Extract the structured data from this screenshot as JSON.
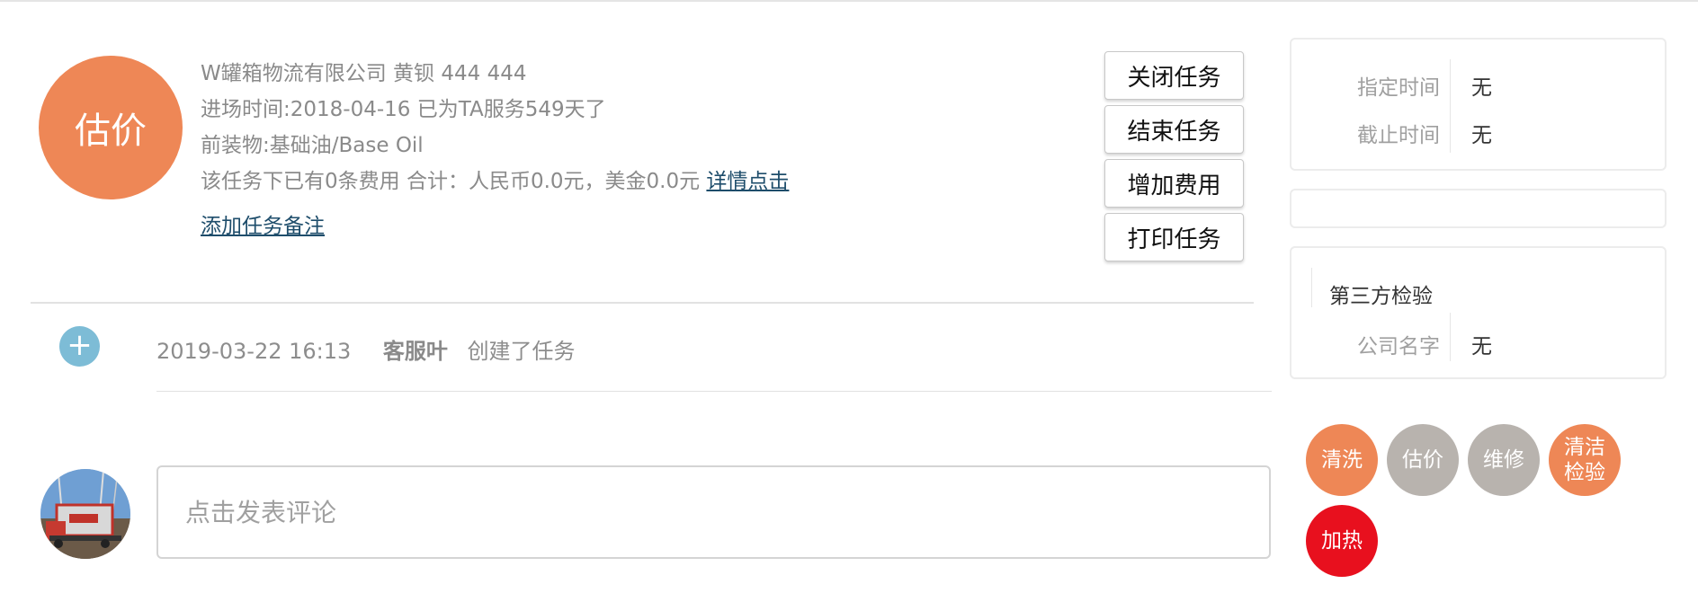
{
  "task": {
    "badge": "估价",
    "company_line": "W罐箱物流有限公司 黄钡 444 444",
    "entry_line": "进场时间:2018-04-16 已为TA服务549天了",
    "cargo_line": "前装物:基础油/Base Oil",
    "fee_line": "该任务下已有0条费用 合计：人民币0.0元，美金0.0元",
    "fee_detail_link": "详情点击",
    "add_note_link": "添加任务备注"
  },
  "actions": {
    "close": "关闭任务",
    "finish": "结束任务",
    "add_fee": "增加费用",
    "print": "打印任务"
  },
  "log": {
    "time": "2019-03-22 16:13",
    "user": "客服叶",
    "action": "创建了任务"
  },
  "comment": {
    "placeholder": "点击发表评论"
  },
  "panel_time": {
    "assigned_label": "指定时间",
    "assigned_value": "无",
    "deadline_label": "截止时间",
    "deadline_value": "无"
  },
  "panel_inspection": {
    "title": "第三方检验",
    "company_label": "公司名字",
    "company_value": "无"
  },
  "tags": [
    {
      "label": "清洗",
      "color": "#ee8756"
    },
    {
      "label": "估价",
      "color": "#b8b3ae"
    },
    {
      "label": "维修",
      "color": "#b8b3ae"
    },
    {
      "label": "清洁检验",
      "color": "#ee8756"
    },
    {
      "label": "加热",
      "color": "#e8101e"
    }
  ],
  "colors": {
    "accent_orange": "#ee8756",
    "plus_blue": "#7dbcd6",
    "link": "#1e4d6b",
    "tag_gray": "#b8b3ae",
    "tag_red": "#e8101e"
  }
}
